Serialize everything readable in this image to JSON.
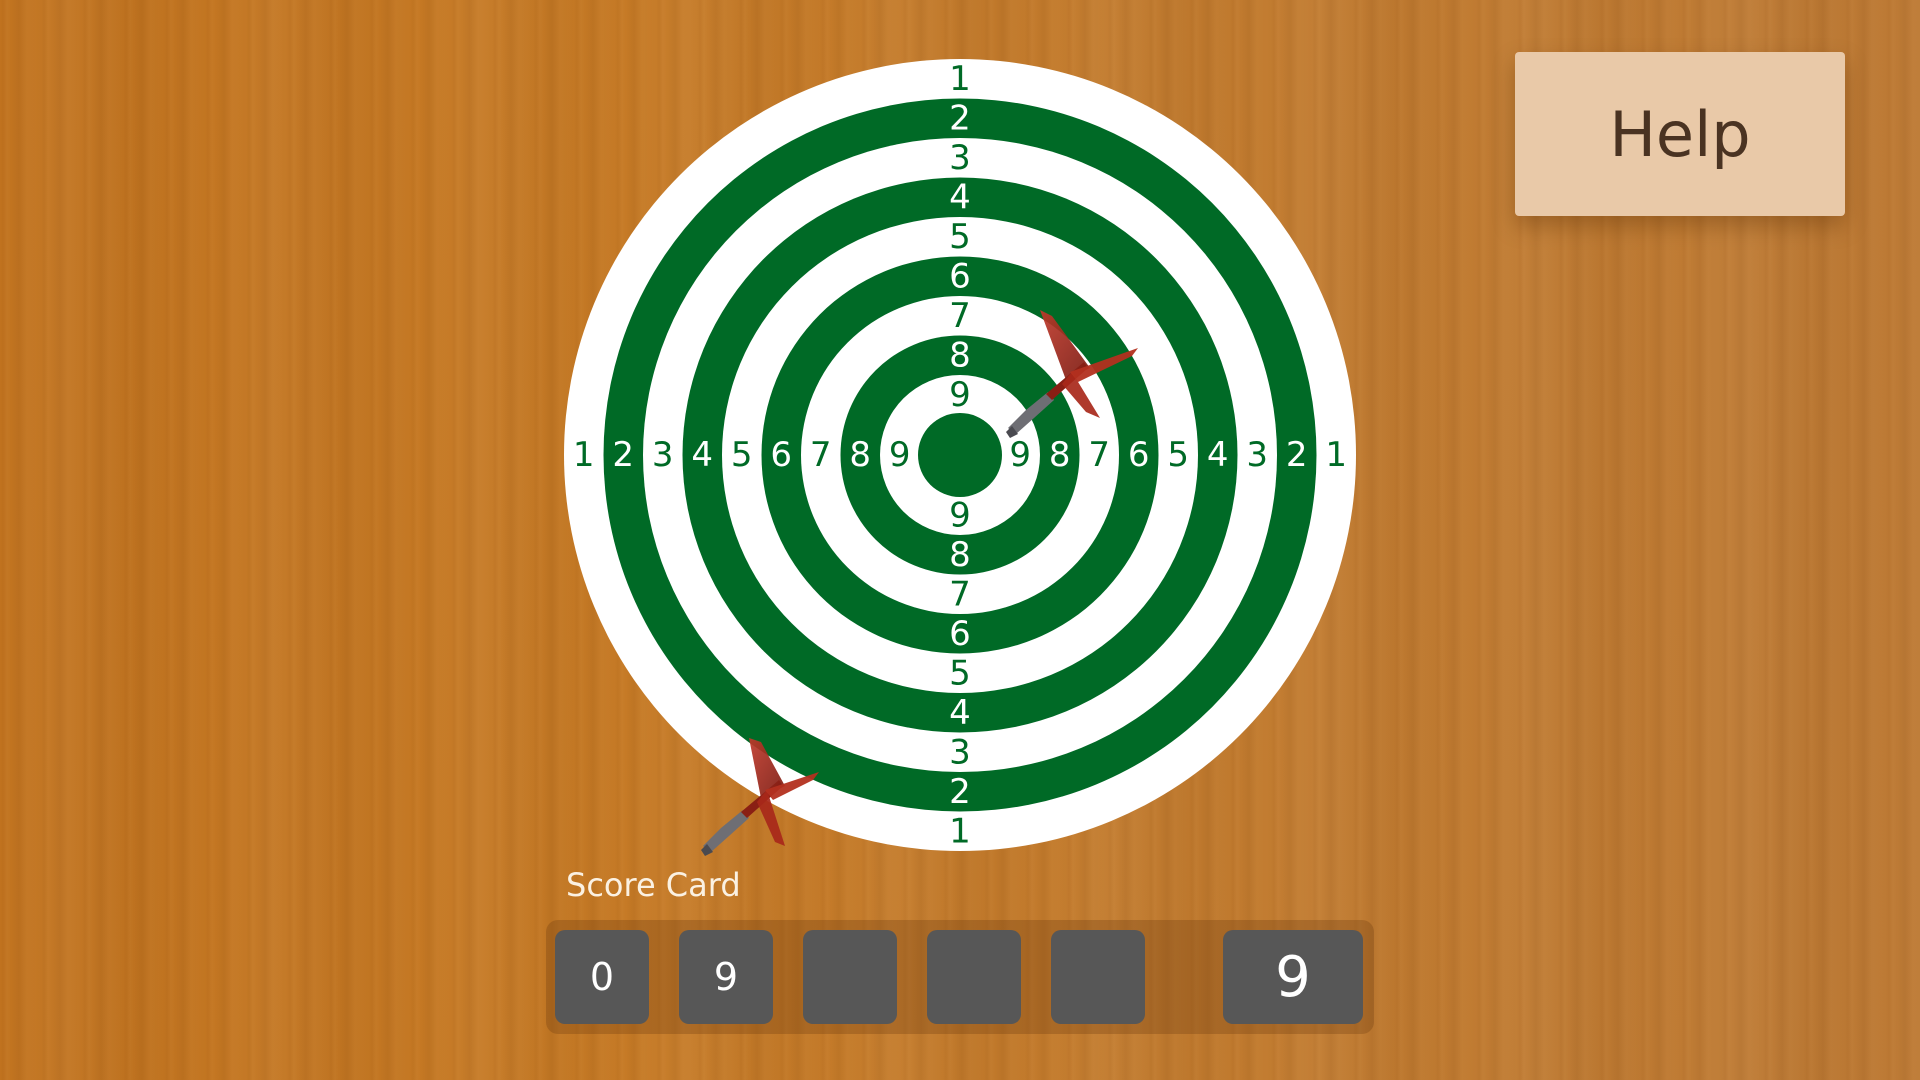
{
  "help_button": {
    "label": "Help"
  },
  "target": {
    "ring_numbers": [
      "1",
      "2",
      "3",
      "4",
      "5",
      "6",
      "7",
      "8",
      "9"
    ],
    "colors": {
      "green": "#006a26",
      "white": "#ffffff"
    }
  },
  "darts": [
    {
      "name": "dart-in-ring-8"
    },
    {
      "name": "dart-in-ring-1"
    }
  ],
  "score_card": {
    "title": "Score Card",
    "scores": [
      "0",
      "9",
      "",
      "",
      ""
    ],
    "total": "9"
  }
}
